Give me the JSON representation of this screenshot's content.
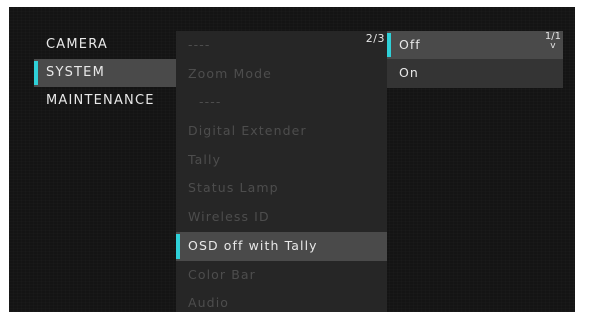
{
  "menu": {
    "items": [
      {
        "label": "CAMERA"
      },
      {
        "label": "SYSTEM"
      },
      {
        "label": "MAINTENANCE"
      }
    ],
    "selected_index": 1
  },
  "submenu": {
    "page_indicator": "2/3",
    "items": [
      {
        "label": "----"
      },
      {
        "label": "Zoom Mode"
      },
      {
        "label": "----"
      },
      {
        "label": "Digital Extender"
      },
      {
        "label": "Tally"
      },
      {
        "label": "Status Lamp"
      },
      {
        "label": "Wireless ID"
      },
      {
        "label": "OSD off with Tally"
      },
      {
        "label": "Color Bar"
      },
      {
        "label": "Audio"
      }
    ],
    "selected_index": 7
  },
  "options": {
    "page_indicator": "1/1",
    "scroll_glyph": "v",
    "items": [
      {
        "label": "Off"
      },
      {
        "label": "On"
      }
    ],
    "selected_index": 0
  },
  "colors": {
    "accent": "#2fd0d8",
    "background": "#141414",
    "highlight": "#4a4a4a",
    "disabled_text": "#4d4d4d"
  }
}
